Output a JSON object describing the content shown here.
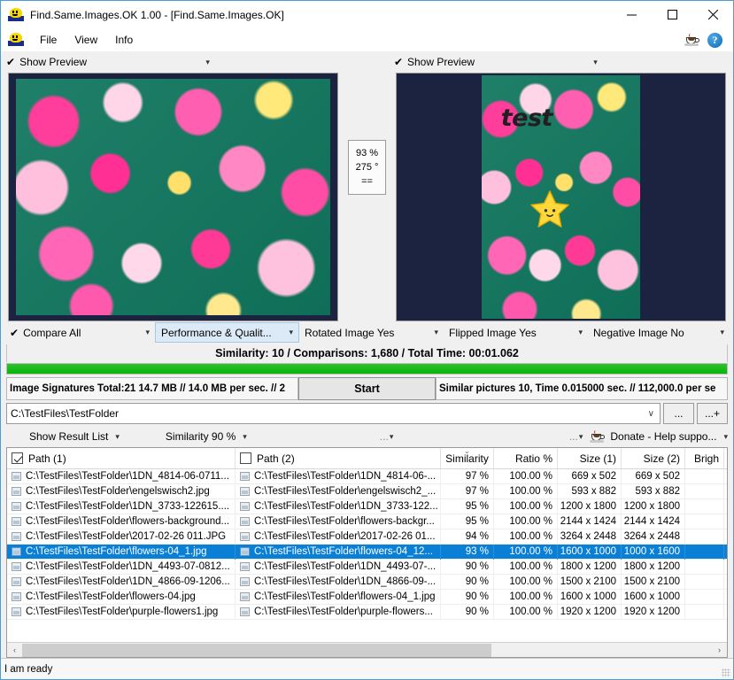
{
  "window": {
    "title": "Find.Same.Images.OK 1.00 - [Find.Same.Images.OK]",
    "app_icon": "smiley-app-icon",
    "minimize_label": "–",
    "maximize_label": "□",
    "close_label": "✕"
  },
  "menu": {
    "icon": "smiley-app-icon",
    "items": [
      {
        "label": "File"
      },
      {
        "label": "View"
      },
      {
        "label": "Info"
      }
    ],
    "right_icons": [
      {
        "name": "coffee-donate-icon"
      },
      {
        "name": "help-question-icon",
        "glyph": "?"
      }
    ]
  },
  "previews": {
    "left": {
      "toggle_label": "Show Preview",
      "checked_glyph": "✔",
      "caret_glyph": "▾",
      "image_desc": "pink-roses-photo"
    },
    "right": {
      "toggle_label": "Show Preview",
      "checked_glyph": "✔",
      "caret_glyph": "▾",
      "image_desc": "pink-roses-photo-with-overlay",
      "overlay_text": "test",
      "overlay_sticker": "yellow-star-sticker"
    },
    "match_info": {
      "similarity": "93 %",
      "rotation": "275 °",
      "equality": "=="
    }
  },
  "options": [
    {
      "name": "compare-all",
      "label": "Compare All",
      "check": "✔",
      "caret": "▾"
    },
    {
      "name": "performance-quality",
      "label": "Performance & Qualit...",
      "caret": "▾"
    },
    {
      "name": "rotated-image",
      "label": "Rotated Image Yes",
      "caret": "▾"
    },
    {
      "name": "flipped-image",
      "label": "Flipped Image Yes",
      "caret": "▾"
    },
    {
      "name": "negative-image",
      "label": "Negative Image No",
      "caret": "▾"
    }
  ],
  "status": {
    "similarity_line": "Similarity: 10 / Comparisons: 1,680 / Total Time: 00:01.062",
    "progress_percent": 100,
    "progress_color": "#06b406",
    "signatures_left": "Image Signatures Total:21  14.7 MB // 14.0 MB per sec. // 2",
    "start_button": "Start",
    "signatures_right": "Similar pictures 10, Time 0.015000 sec. // 112,000.0 per se",
    "bottom": "I am ready"
  },
  "path": {
    "value": "C:\\TestFiles\\TestFolder",
    "caret": "∨",
    "browse_label": "...",
    "browse_add_label": "...+"
  },
  "result_toolbar": {
    "show_result_list": "Show Result List",
    "similarity_filter": "Similarity 90 %",
    "dots_middle": "...",
    "dots_right": "...",
    "donate_label": "Donate - Help suppo...",
    "donate_icon": "coffee-cup-icon",
    "caret": "▾"
  },
  "table": {
    "columns": [
      {
        "name": "path1",
        "label": "Path (1)",
        "checkbox": true,
        "checked": true,
        "align": "left"
      },
      {
        "name": "path2",
        "label": "Path (2)",
        "checkbox": true,
        "checked": false,
        "align": "left"
      },
      {
        "name": "similarity",
        "label": "Similarity",
        "align": "center",
        "sorted": true
      },
      {
        "name": "ratio",
        "label": "Ratio %",
        "align": "right"
      },
      {
        "name": "size1",
        "label": "Size (1)",
        "align": "right"
      },
      {
        "name": "size2",
        "label": "Size (2)",
        "align": "right"
      },
      {
        "name": "brightness",
        "label": "Brigh",
        "align": "right"
      }
    ],
    "rows": [
      {
        "path1": "C:\\TestFiles\\TestFolder\\1DN_4814-06-0711...",
        "path2": "C:\\TestFiles\\TestFolder\\1DN_4814-06-...",
        "similarity": "97 %",
        "ratio": "100.00 %",
        "size1": "669 x 502",
        "size2": "669 x 502",
        "brightness": "",
        "selected": false
      },
      {
        "path1": "C:\\TestFiles\\TestFolder\\engelswisch2.jpg",
        "path2": "C:\\TestFiles\\TestFolder\\engelswisch2_...",
        "similarity": "97 %",
        "ratio": "100.00 %",
        "size1": "593 x 882",
        "size2": "593 x 882",
        "brightness": "",
        "selected": false
      },
      {
        "path1": "C:\\TestFiles\\TestFolder\\1DN_3733-122615....",
        "path2": "C:\\TestFiles\\TestFolder\\1DN_3733-122...",
        "similarity": "95 %",
        "ratio": "100.00 %",
        "size1": "1200 x 1800",
        "size2": "1200 x 1800",
        "brightness": "",
        "selected": false
      },
      {
        "path1": "C:\\TestFiles\\TestFolder\\flowers-background...",
        "path2": "C:\\TestFiles\\TestFolder\\flowers-backgr...",
        "similarity": "95 %",
        "ratio": "100.00 %",
        "size1": "2144 x 1424",
        "size2": "2144 x 1424",
        "brightness": "",
        "selected": false
      },
      {
        "path1": "C:\\TestFiles\\TestFolder\\2017-02-26 011.JPG",
        "path2": "C:\\TestFiles\\TestFolder\\2017-02-26 01...",
        "similarity": "94 %",
        "ratio": "100.00 %",
        "size1": "3264 x 2448",
        "size2": "3264 x 2448",
        "brightness": "",
        "selected": false
      },
      {
        "path1": "C:\\TestFiles\\TestFolder\\flowers-04_1.jpg",
        "path2": "C:\\TestFiles\\TestFolder\\flowers-04_12...",
        "similarity": "93 %",
        "ratio": "100.00 %",
        "size1": "1600 x 1000",
        "size2": "1000 x 1600",
        "brightness": "",
        "selected": true
      },
      {
        "path1": "C:\\TestFiles\\TestFolder\\1DN_4493-07-0812...",
        "path2": "C:\\TestFiles\\TestFolder\\1DN_4493-07-...",
        "similarity": "90 %",
        "ratio": "100.00 %",
        "size1": "1800 x 1200",
        "size2": "1800 x 1200",
        "brightness": "",
        "selected": false
      },
      {
        "path1": "C:\\TestFiles\\TestFolder\\1DN_4866-09-1206...",
        "path2": "C:\\TestFiles\\TestFolder\\1DN_4866-09-...",
        "similarity": "90 %",
        "ratio": "100.00 %",
        "size1": "1500 x 2100",
        "size2": "1500 x 2100",
        "brightness": "",
        "selected": false
      },
      {
        "path1": "C:\\TestFiles\\TestFolder\\flowers-04.jpg",
        "path2": "C:\\TestFiles\\TestFolder\\flowers-04_1.jpg",
        "similarity": "90 %",
        "ratio": "100.00 %",
        "size1": "1600 x 1000",
        "size2": "1600 x 1000",
        "brightness": "",
        "selected": false
      },
      {
        "path1": "C:\\TestFiles\\TestFolder\\purple-flowers1.jpg",
        "path2": "C:\\TestFiles\\TestFolder\\purple-flowers...",
        "similarity": "90 %",
        "ratio": "100.00 %",
        "size1": "1920 x 1200",
        "size2": "1920 x 1200",
        "brightness": "",
        "selected": false
      }
    ],
    "scroll_left_arrow": "‹",
    "scroll_right_arrow": "›"
  },
  "colors": {
    "selection_blue": "#0a7fd6",
    "progress_green": "#06b406",
    "window_border": "#4a9ed8",
    "highlight_option": "#dceaf7"
  }
}
